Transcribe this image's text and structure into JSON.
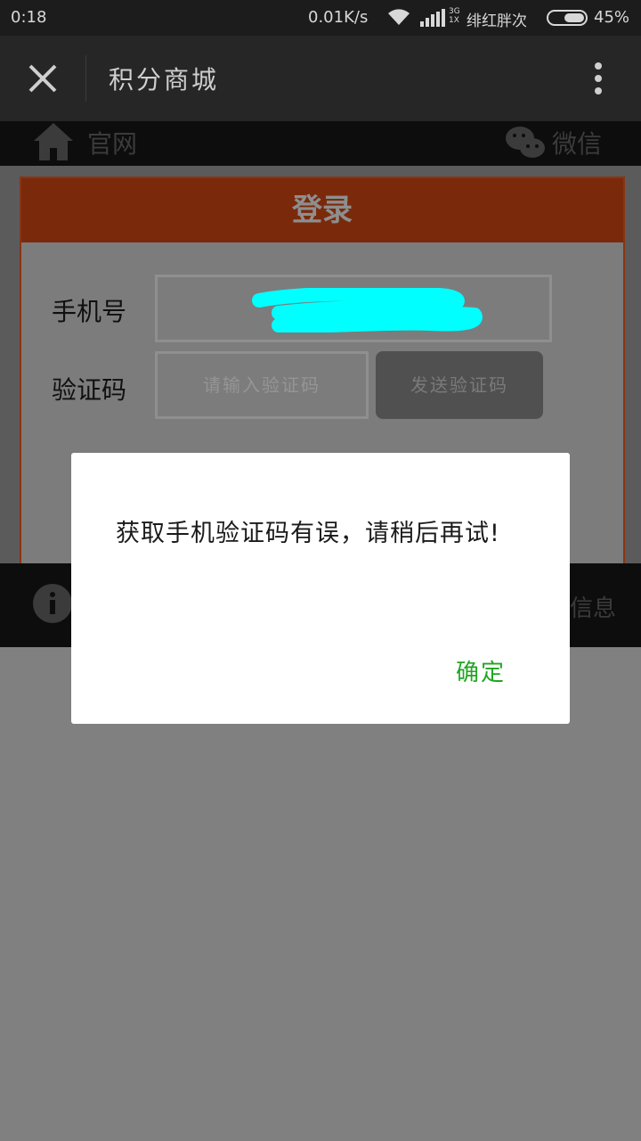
{
  "status_bar": {
    "time": "0:18",
    "speed": "0.01K/s",
    "net_type_top": "3G",
    "net_type_bottom": "1X",
    "carrier": "绯红胖次",
    "battery": "45%"
  },
  "app_bar": {
    "title": "积分商城",
    "close_icon": "close-icon",
    "more_icon": "more-vert-icon"
  },
  "nav": {
    "home_label": "官网",
    "wechat_label": "微信"
  },
  "login": {
    "header": "登录",
    "phone_label": "手机号",
    "code_label": "验证码",
    "code_placeholder": "请输入验证码",
    "send_button": "发送验证码"
  },
  "footer": {
    "info_icon": "info-icon",
    "message_label": "信息"
  },
  "dialog": {
    "message": "获取手机验证码有误，请稍后再试!",
    "ok_label": "确定"
  },
  "colors": {
    "login_header": "#7a2a0b",
    "ok_text": "#22a522",
    "scribble": "#00ffff"
  }
}
